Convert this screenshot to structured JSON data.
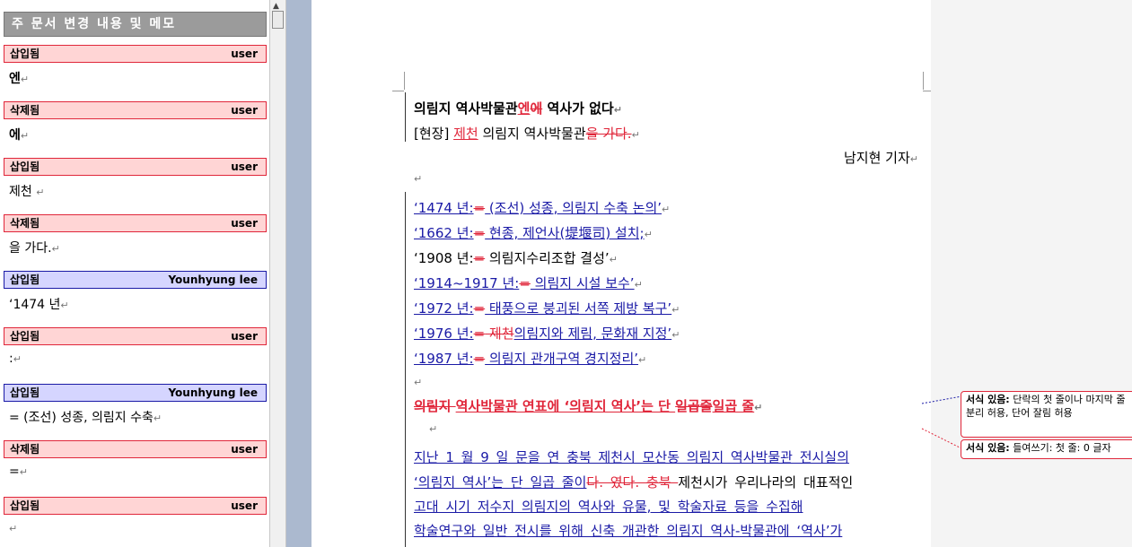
{
  "reviewing_pane": {
    "title": "주 문서 변경 내용 및 메모",
    "items": [
      {
        "type": "삽입됨",
        "author": "user",
        "text": "엔",
        "color": "red"
      },
      {
        "type": "삭제됨",
        "author": "user",
        "text": "에",
        "color": "red"
      },
      {
        "type": "삽입됨",
        "author": "user",
        "text": "제천 ",
        "color": "red"
      },
      {
        "type": "삭제됨",
        "author": "user",
        "text": "을 가다.",
        "color": "red"
      },
      {
        "type": "삽입됨",
        "author": "Younhyung lee",
        "text": "‘1474 년",
        "color": "blue"
      },
      {
        "type": "삽입됨",
        "author": "user",
        "text": ":",
        "color": "red"
      },
      {
        "type": "삽입됨",
        "author": "Younhyung lee",
        "text": "= (조선) 성종, 의림지 수축",
        "color": "blue"
      },
      {
        "type": "삭제됨",
        "author": "user",
        "text": "=",
        "color": "red"
      },
      {
        "type": "삽입됨",
        "author": "user",
        "text": "",
        "color": "red"
      }
    ]
  },
  "document": {
    "headline": {
      "a": "의림지 역사박물관",
      "ins": "엔",
      "del": "에",
      "b": " 역사가 없다"
    },
    "subline": {
      "a": "[현장] ",
      "ins": "제천",
      "b": " 의림지 역사박물관",
      "del": "을 가다."
    },
    "byline": "남지현 기자",
    "timeline": [
      {
        "year": "‘1474 년:",
        "arrow": "=",
        "text": " (조선) 성종, 의림지 수축 논의’",
        "style": "ins"
      },
      {
        "year": "‘1662 년:",
        "arrow": "=",
        "text": " 현종, 제언사(堤堰司) 설치;",
        "style": "ins"
      },
      {
        "year": "‘1908 년:",
        "arrow": "=",
        "text": " 의림지수리조합 결성’",
        "style": "plain"
      },
      {
        "year": "‘1914~1917 년:",
        "arrow": "=",
        "text": " 의림지 시설 보수’",
        "style": "ins"
      },
      {
        "year": "‘1972 년:",
        "arrow": "=",
        "text": " 태풍으로 붕괴된 서쪽 제방 복구’",
        "style": "ins"
      },
      {
        "year": "‘1976 년:",
        "arrow": "=",
        "del": " 제천",
        "text": "의림지와 제림, 문화재 지정’",
        "style": "ins"
      },
      {
        "year": "‘1987 년:",
        "arrow": "=",
        "text": " 의림지 관개구역 경지정리’",
        "style": "ins"
      }
    ],
    "section_title": {
      "del1": "의림지 ",
      "a": "역사박물관 연표에 ‘의림지 역사’는 단 ",
      "del2": "일곱줄",
      "ins": "일곱 줄"
    },
    "body_lines": [
      "   지난 1 월 9 일 문을 연 충북 제천시 모산동 의림지 역사박물관 전시실의",
      "‘의림지 역사’는 단 일곱 줄이",
      "고대 시기 저수지 의림지의 역사와 유물, 및 학술자료 등을 수집해",
      "학술연구와 일반 전시를 위해 신축 개관한 의림지 역사-박물관에 ‘역사’가"
    ],
    "body_line2_del": "다. 였다. 충북 ",
    "body_line2_tail": "제천시가 우리나라의 대표적인"
  },
  "balloons": [
    {
      "label": "서식 있음:",
      "text": " 단락의 첫 줄이나 마지막 줄 분리 허용, 단어 잘림 허용"
    },
    {
      "label": "서식 있음:",
      "text": " 들여쓰기: 첫 줄:  0 글자"
    }
  ]
}
